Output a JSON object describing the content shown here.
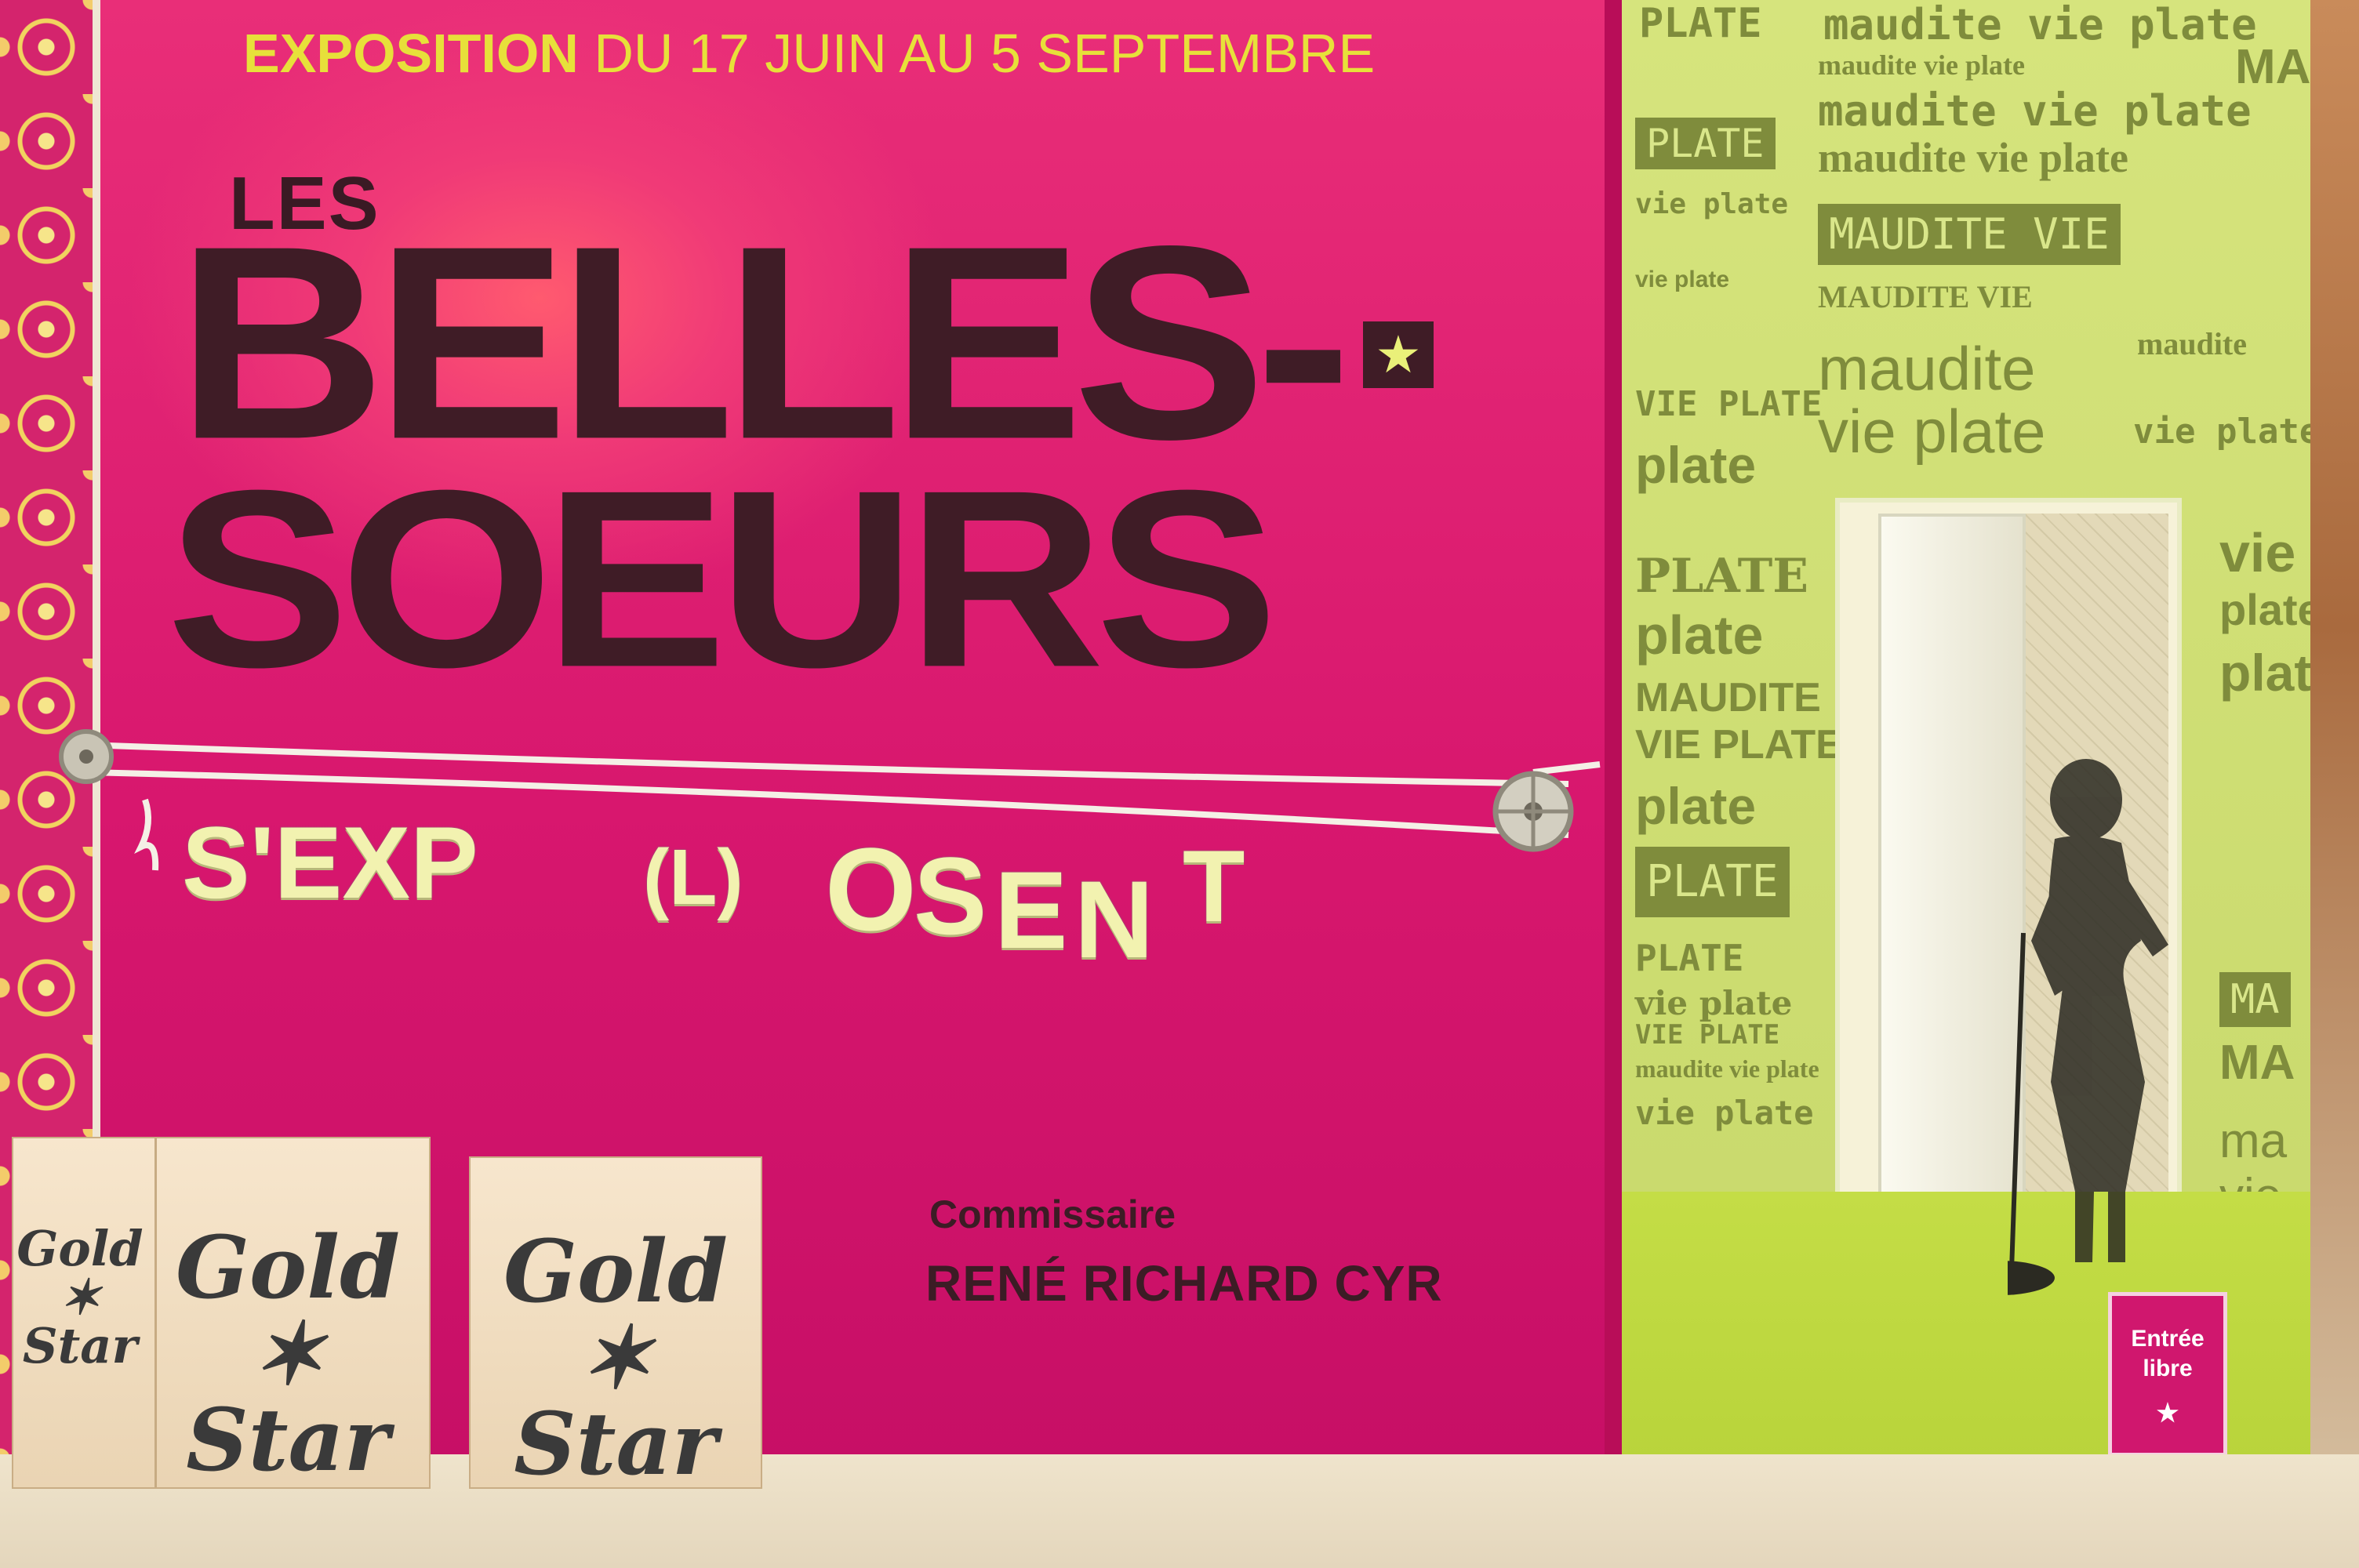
{
  "poster": {
    "expo_prefix": "EXPOSITION",
    "expo_dates": "DU 17 JUIN AU 5 SEPTEMBRE",
    "title_les": "LES",
    "title_belles": "BELLES-",
    "title_soeurs": "SOEURS",
    "star": "★",
    "clothesline_letters": [
      "S'EXP",
      "(L)",
      "O",
      "S",
      "E",
      "N",
      "T"
    ],
    "commissaire_label": "Commissaire",
    "commissaire_name": "RENÉ RICHARD CYR"
  },
  "boxes": {
    "logo_line1": "Gold",
    "logo_star": "✶",
    "logo_line2": "Star"
  },
  "green_panel": {
    "words": [
      "PLATE",
      "maudite vie plate",
      "maudite vie plate",
      "MA",
      "maudite vie plate",
      "PLATE",
      "maudite vie plate",
      "MAUDITE VIE",
      "vie plate",
      "MAUDITE VIE",
      "vie plate",
      "maudite",
      "VIE PLATE",
      "vie plate",
      "maudite",
      "vie plate",
      "plate",
      "plate",
      "vie",
      "PLATE",
      "plate",
      "MAUDITE",
      "VIE PLATE",
      "plate",
      "plate",
      "PLATE",
      "PLATE",
      "vie plate",
      "VIE PLATE",
      "maudite vie plate",
      "vie plate",
      "MA",
      "MA",
      "ma",
      "vie"
    ],
    "entree_line1": "Entrée",
    "entree_line2": "libre",
    "entree_star": "★"
  },
  "colors": {
    "banner": "#d8176e",
    "title_text": "#3f1c26",
    "accent_yellow": "#e7e03a",
    "green_panel": "#d1e177"
  }
}
